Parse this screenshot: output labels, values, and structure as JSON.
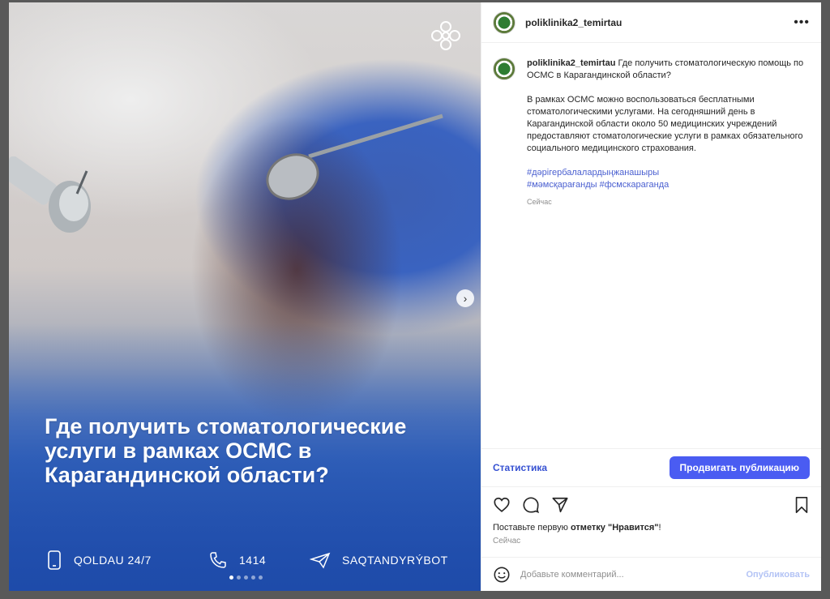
{
  "post": {
    "account": "poliklinika2_temirtau",
    "menu_icon": "more-horizontal-icon",
    "media": {
      "headline": "Где получить стоматологические услуги в рамках ОСМС в Карагандинской области?",
      "contacts": [
        {
          "icon": "phone-icon",
          "label": "QOLDAU 24/7"
        },
        {
          "icon": "handset-icon",
          "label": "1414"
        },
        {
          "icon": "send-icon",
          "label": "SAQTANDYRÝBOT"
        }
      ],
      "slide_count": 5,
      "active_slide": 1
    },
    "caption": {
      "username": "poliklinika2_temirtau",
      "first_line": "Где получить стоматологическую помощь по ОСМС в Карагандинской области?",
      "paragraph": "В рамках ОСМС можно воспользоваться бесплатными стоматологическими услугами. На сегодняшний день в Карагандинской области около 50 медицинских учреждений предоставляют стоматологические услуги в рамках обязательного социального медицинского страхования.",
      "hashtags": [
        "#дәрігербалалардыңжанашыры",
        "#мәмсқарағанды #фсмскараганда"
      ],
      "time": "Сейчас"
    },
    "promo": {
      "stats_label": "Статистика",
      "promote_label": "Продвигать публикацию"
    },
    "likes": {
      "prefix": "Поставьте первую",
      "emphasis": "отметку \"Нравится\"",
      "suffix": "!"
    },
    "time": "Сейчас",
    "comment": {
      "placeholder": "Добавьте комментарий...",
      "publish_label": "Опубликовать"
    }
  }
}
